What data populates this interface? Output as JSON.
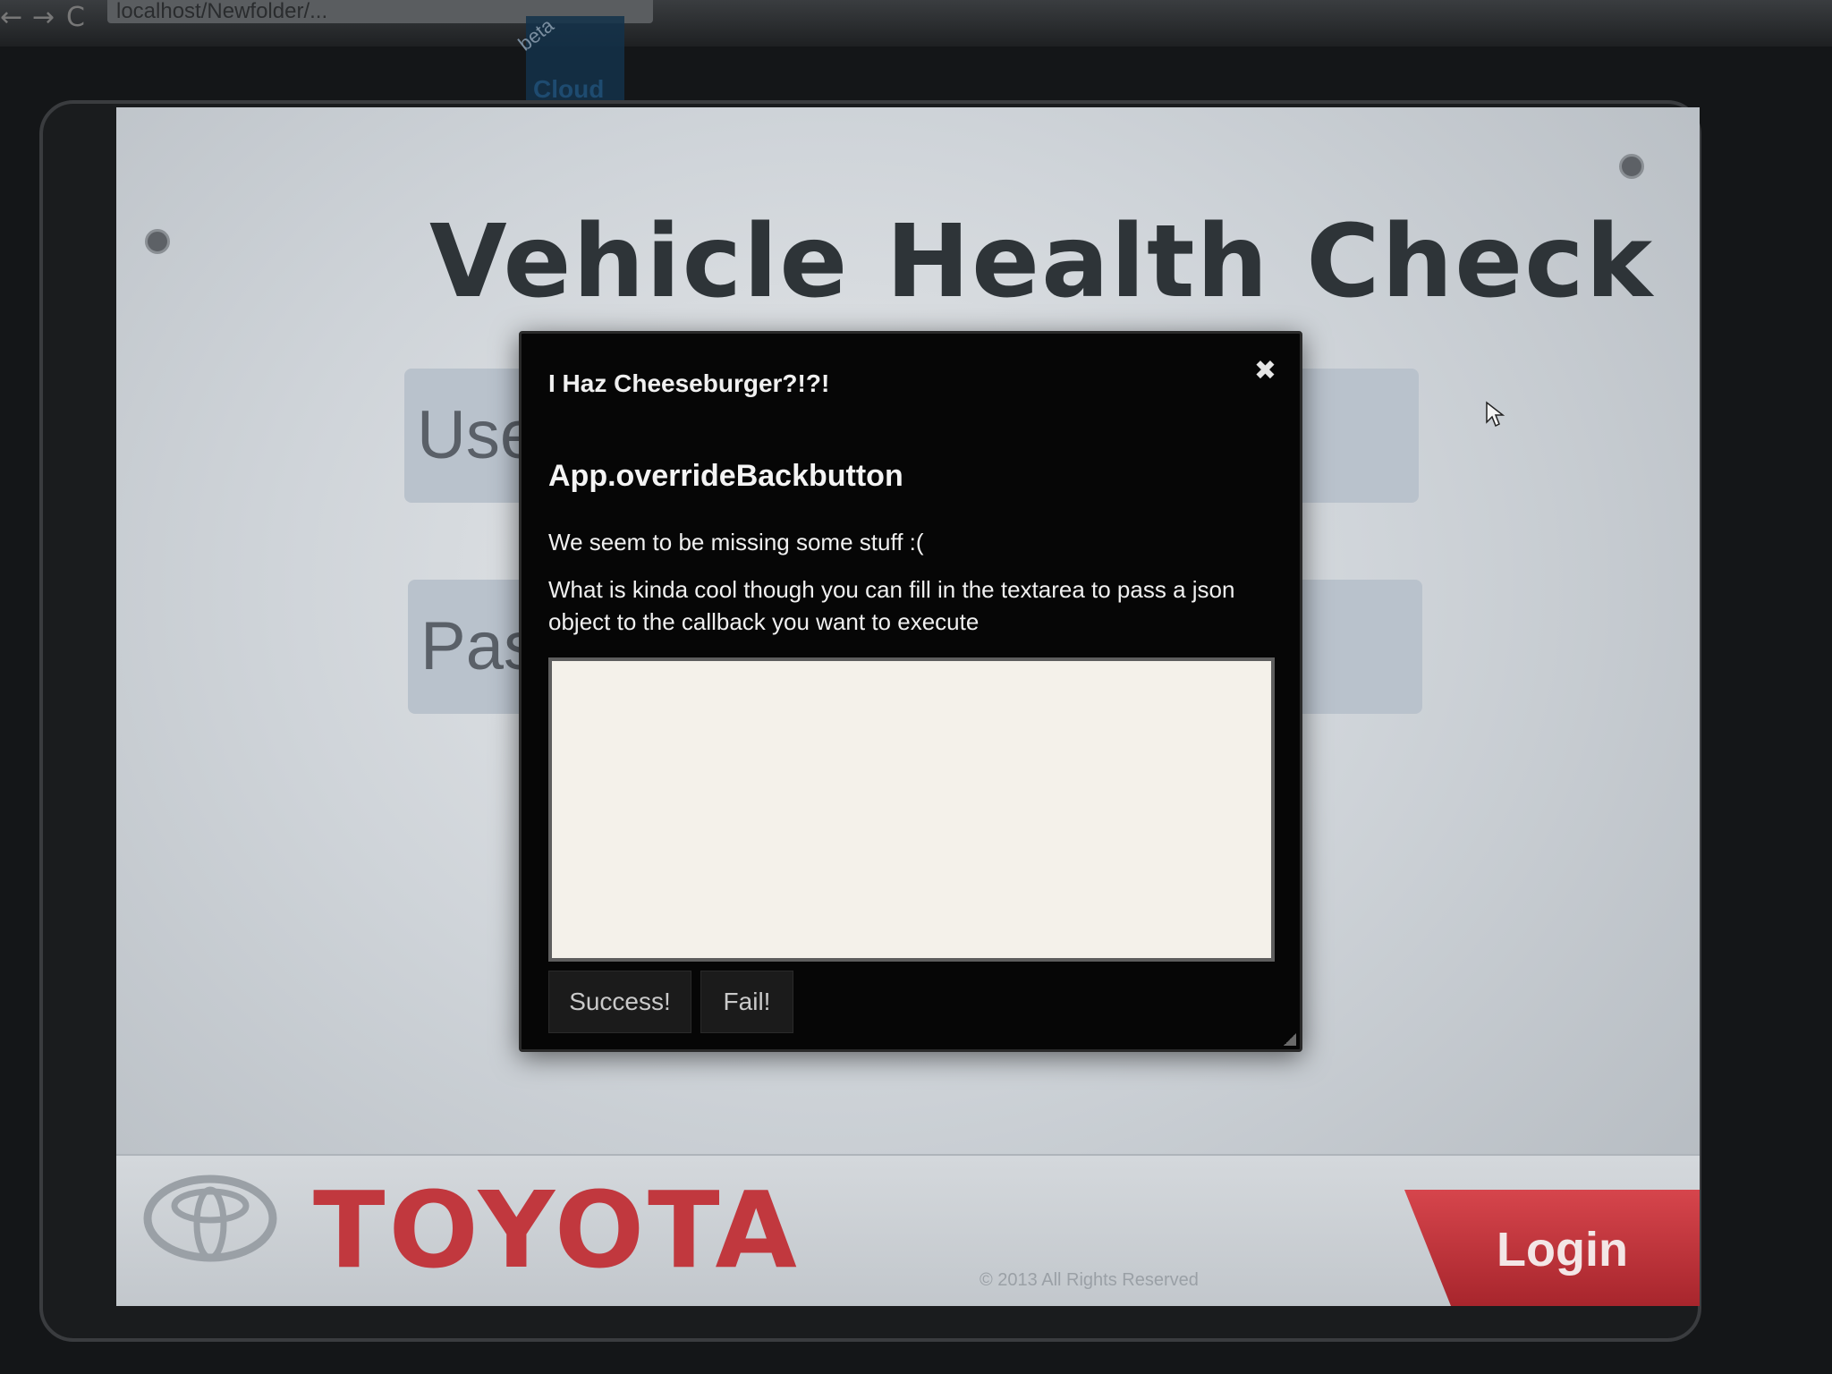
{
  "browser": {
    "back_icon": "←",
    "forward_icon": "→",
    "reload_icon": "C",
    "url": "localhost/Newfolder/..."
  },
  "page_icon": {
    "beta": "beta",
    "label": "Cloud"
  },
  "app": {
    "title": "Vehicle Health Check",
    "username_placeholder": "Use",
    "password_placeholder": "Pas"
  },
  "footer": {
    "brand": "TOYOTA",
    "copyright": "© 2013 All Rights Reserved",
    "login_label": "Login"
  },
  "modal": {
    "title": "I Haz Cheeseburger?!?!",
    "close_icon": "✖",
    "heading": "App.overrideBackbutton",
    "message1": "We seem to be missing some stuff :(",
    "message2": "What is kinda cool though you can fill in the textarea to pass a json object to the callback you want to execute",
    "textarea_value": "",
    "success_label": "Success!",
    "fail_label": "Fail!"
  },
  "colors": {
    "brand_red": "#c1383e",
    "login_red": "#c7343b",
    "modal_bg": "#060606"
  }
}
